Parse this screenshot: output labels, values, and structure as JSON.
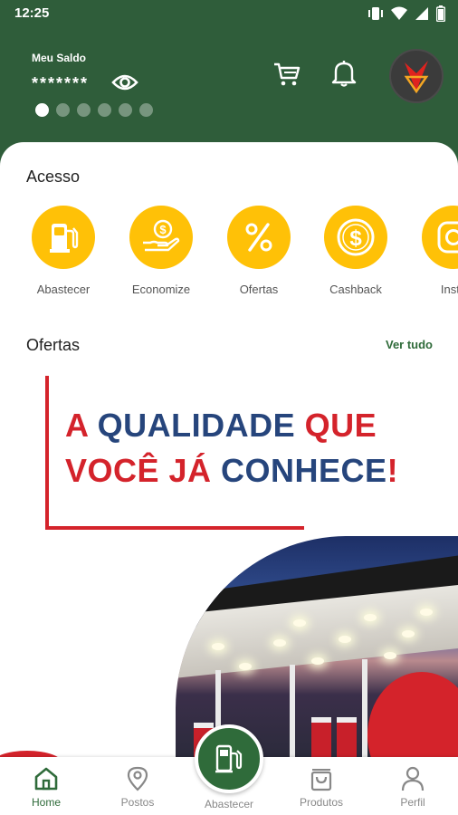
{
  "status": {
    "time": "12:25"
  },
  "header": {
    "balance_label": "Meu Saldo",
    "balance_value": "*******",
    "carousel_dots": 6,
    "carousel_active_index": 0
  },
  "acesso": {
    "title": "Acesso",
    "items": [
      {
        "label": "Abastecer",
        "icon": "fuel-pump-icon"
      },
      {
        "label": "Economize",
        "icon": "money-hand-icon"
      },
      {
        "label": "Ofertas",
        "icon": "percent-icon"
      },
      {
        "label": "Cashback",
        "icon": "dollar-coin-icon"
      },
      {
        "label": "Insta",
        "icon": "instagram-icon"
      }
    ]
  },
  "ofertas": {
    "title": "Ofertas",
    "see_all": "Ver tudo",
    "banner": {
      "line1_a": "A ",
      "line1_b": "QUALIDADE ",
      "line1_c": "QUE",
      "line2_a": "VOCÊ JÁ ",
      "line2_b": "CONHECE",
      "line2_c": "!"
    }
  },
  "nav": {
    "home": "Home",
    "postos": "Postos",
    "abastecer": "Abastecer",
    "produtos": "Produtos",
    "perfil": "Perfil"
  },
  "colors": {
    "brand_green": "#2f5d3a",
    "accent_yellow": "#ffc107",
    "banner_red": "#d4232b",
    "banner_blue": "#26457c"
  }
}
